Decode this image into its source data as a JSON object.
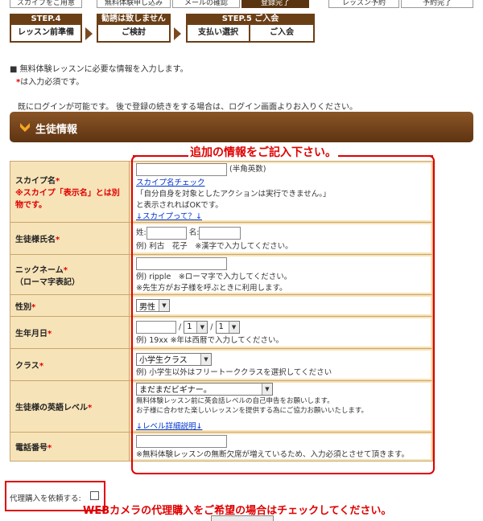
{
  "steps_top": [
    "スカイプをご用意",
    "無料体験申し込み",
    "メールの確認",
    "登録完了",
    "レッスン予約",
    "予約完了"
  ],
  "steps": [
    {
      "head": "STEP.4",
      "label": "レッスン前準備"
    },
    {
      "head": "勧誘は致しません",
      "label": "ご検討"
    },
    {
      "head": "STEP.5 ご入会",
      "label": "支払い選択"
    },
    {
      "head": "",
      "label": "ご入会"
    }
  ],
  "notice": {
    "line1": "■ 無料体験レッスンに必要な情報を入力します。",
    "req_mark": "*",
    "line2": "は入力必須です。",
    "line3": "既にログインが可能です。 後で登録の続きをする場合は、ログイン画面よりお入りください。"
  },
  "section": {
    "title": "生徒情報"
  },
  "callout": {
    "title": "追加の情報をご記入下さい。"
  },
  "form": {
    "skype": {
      "label": "スカイプ名",
      "label_note": "※スカイプ「表示名」とは別物です。",
      "hint": "(半角英数)",
      "check_link": "スカイプ名チェック",
      "note1": "「自分自身を対象としたアクションは実行できません。」",
      "note2": "と表示されればOKです。",
      "help_link": "↓スカイプって？↓"
    },
    "name": {
      "label": "生徒様氏名",
      "sei": "姓:",
      "mei": "名:",
      "example": "例) 利古　花子　※漢字で入力してください。"
    },
    "nickname": {
      "label": "ニックネーム",
      "label_sub": "（ローマ字表記）",
      "note1": "例) ripple　※ローマ字で入力してください。",
      "note2": "※先生方がお子様を呼ぶときに利用します。"
    },
    "gender": {
      "label": "性別",
      "value": "男性"
    },
    "birth": {
      "label": "生年月日",
      "month": "1",
      "day": "1",
      "sep": "/",
      "note": "例) 19xx ※年は西暦で入力してください。"
    },
    "class": {
      "label": "クラス",
      "value": "小学生クラス",
      "note": "例) 小学生以外はフリートーククラスを選択してください"
    },
    "level": {
      "label": "生徒様の英語レベル",
      "value": "まだまだビギナー。",
      "note1": "無料体験レッスン前に英会話レベルの自己申告をお願いします。",
      "note2": "お子様に合わせた楽しいレッスンを提供する為にご協力お願いいたします。",
      "link": "↓レベル詳細説明↓"
    },
    "phone": {
      "label": "電話番号",
      "note": "※無料体験レッスンの無断欠席が増えているため、入力必須とさせて頂きます。"
    }
  },
  "proxy": {
    "label": "代理購入を依頼する:"
  },
  "web_note": "WEBカメラの代理購入をご希望の場合はチェックしてください。",
  "colors": {
    "brown": "#6b3f16",
    "red": "#e00000",
    "label_bg": "#f7e3b8",
    "link": "#0033cc"
  }
}
